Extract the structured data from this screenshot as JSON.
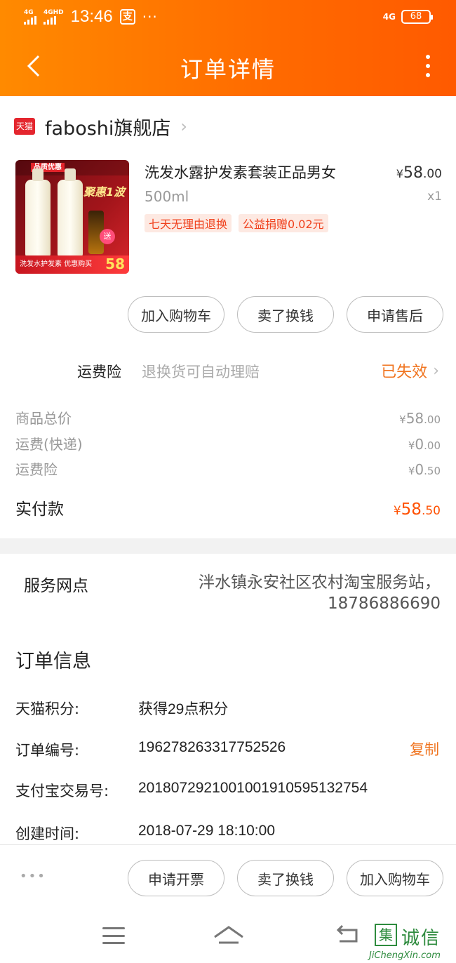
{
  "status_bar": {
    "network_1": "4G",
    "network_2": "4GHD",
    "time": "13:46",
    "alipay_glyph": "支",
    "dots": "···",
    "network_right": "4G",
    "battery": "68"
  },
  "header": {
    "title": "订单详情"
  },
  "shop": {
    "logo_text": "天猫",
    "name": "faboshi旗舰店"
  },
  "product": {
    "image": {
      "badge": "品质优惠",
      "promo": "聚惠1波",
      "send": "送",
      "bottom_caption": "洗发水护发素",
      "bottom_buy": "优惠购买",
      "price": "58"
    },
    "title": "洗发水露护发素套装正品男女",
    "spec": "500ml",
    "price": {
      "currency": "¥",
      "integer": "58",
      "decimal": ".00"
    },
    "quantity": "x1",
    "tags": [
      "七天无理由退换",
      "公益捐赠0.02元"
    ]
  },
  "product_actions": [
    "加入购物车",
    "卖了换钱",
    "申请售后"
  ],
  "insurance": {
    "label": "运费险",
    "description": "退换货可自动理赔",
    "status": "已失效"
  },
  "fees": [
    {
      "label": "商品总价",
      "currency": "¥",
      "integer": "58",
      "decimal": ".00"
    },
    {
      "label": "运费(快递)",
      "currency": "¥",
      "integer": "0",
      "decimal": ".00"
    },
    {
      "label": "运费险",
      "currency": "¥",
      "integer": "0",
      "decimal": ".50"
    }
  ],
  "total": {
    "label": "实付款",
    "currency": "¥",
    "integer": "58",
    "decimal": ".50"
  },
  "service": {
    "label": "服务网点",
    "line1": "泮水镇永安社区农村淘宝服务站，",
    "line2": "18786886690"
  },
  "order_info": {
    "title": "订单信息",
    "rows": [
      {
        "label": "天猫积分:",
        "value": "获得29点积分"
      },
      {
        "label": "订单编号:",
        "value": "196278263317752526"
      },
      {
        "label": "支付宝交易号:",
        "value": "2018072921001001910595132754"
      },
      {
        "label": "创建时间:",
        "value": "2018-07-29 18:10:00"
      }
    ],
    "copy_label": "复制"
  },
  "bottom_bar": {
    "more": "•••",
    "buttons": [
      "申请开票",
      "卖了换钱",
      "加入购物车"
    ]
  },
  "watermark": {
    "box": "集",
    "cn": "诚信",
    "en": "JiChengXin.com"
  },
  "colors": {
    "brand_orange": "#ff6a00",
    "accent": "#f0741f",
    "price_red": "#ff5000",
    "tmall_red": "#e4262e"
  }
}
